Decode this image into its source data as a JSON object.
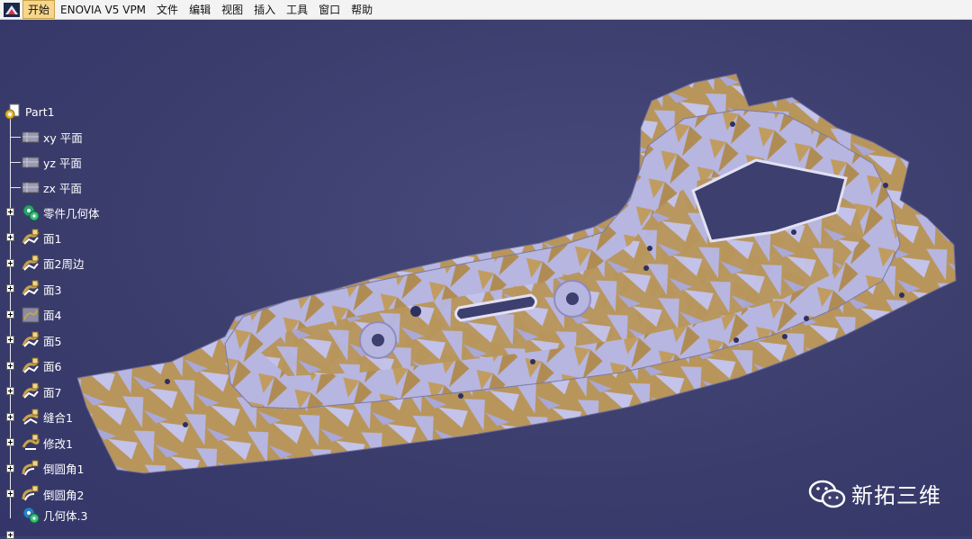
{
  "menu": {
    "items": [
      "开始",
      "ENOVIA V5 VPM",
      "文件",
      "编辑",
      "视图",
      "插入",
      "工具",
      "窗口",
      "帮助"
    ]
  },
  "tree": {
    "root": "Part1",
    "planes": [
      "xy 平面",
      "yz 平面",
      "zx 平面"
    ],
    "body": "零件几何体",
    "features": [
      {
        "label": "面1",
        "icon": "surface-icon"
      },
      {
        "label": "面2周边",
        "icon": "surface-icon"
      },
      {
        "label": "面3",
        "icon": "surface-icon"
      },
      {
        "label": "面4",
        "icon": "surface-hidden-icon"
      },
      {
        "label": "面5",
        "icon": "surface-icon"
      },
      {
        "label": "面6",
        "icon": "surface-icon"
      },
      {
        "label": "面7",
        "icon": "surface-icon"
      },
      {
        "label": "缝合1",
        "icon": "join-icon"
      },
      {
        "label": "修改1",
        "icon": "modify-icon"
      },
      {
        "label": "倒圆角1",
        "icon": "fillet-icon"
      },
      {
        "label": "倒圆角2",
        "icon": "fillet-icon"
      }
    ],
    "geo_set": "几何体.3"
  },
  "watermark": "新拓三维",
  "colors": {
    "background": "#3d3f6e",
    "part_gold": "#b8955a",
    "part_lilac": "#b7b6e0",
    "active_menu": "#f7d58a"
  }
}
